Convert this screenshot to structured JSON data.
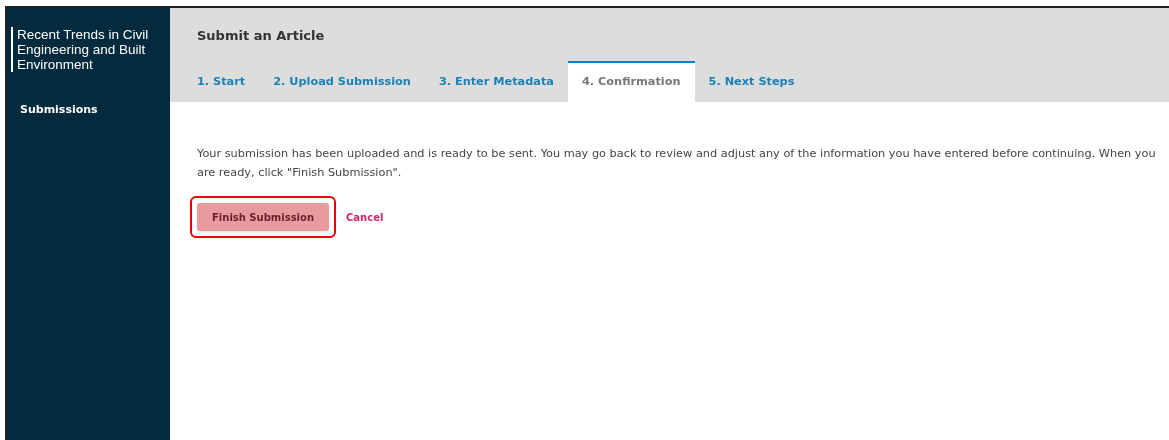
{
  "sidebar": {
    "journal_title": "Recent Trends in Civil Engineering and Built Environment",
    "items": [
      {
        "label": "Submissions",
        "selected": true
      }
    ]
  },
  "header": {
    "title": "Submit an Article"
  },
  "tabs": [
    {
      "label": "1. Start",
      "selected": false
    },
    {
      "label": "2. Upload Submission",
      "selected": false
    },
    {
      "label": "3. Enter Metadata",
      "selected": false
    },
    {
      "label": "4. Confirmation",
      "selected": true
    },
    {
      "label": "5. Next Steps",
      "selected": false
    }
  ],
  "content": {
    "message": "Your submission has been uploaded and is ready to be sent. You may go back to review and adjust any of the information you have entered before continuing. When you are ready, click \"Finish Submission\".",
    "primary_button": "Finish Submission",
    "cancel_link": "Cancel",
    "primary_highlighted": true
  }
}
